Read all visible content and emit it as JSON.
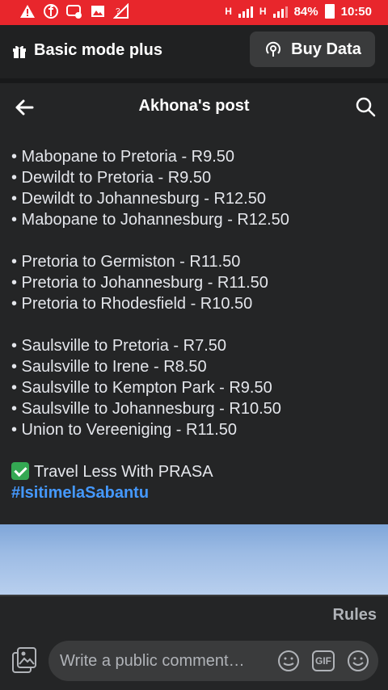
{
  "status_bar": {
    "net1": "H",
    "net2": "H",
    "battery": "84%",
    "time": "10:50"
  },
  "promo": {
    "title": "Basic mode plus",
    "buy_button": "Buy Data"
  },
  "header": {
    "title": "Akhona's post"
  },
  "post": {
    "group1": [
      "• Mabopane to Pretoria - R9.50",
      "• Dewildt to Pretoria - R9.50",
      "• Dewildt to Johannesburg - R12.50",
      "• Mabopane to Johannesburg - R12.50"
    ],
    "group2": [
      "• Pretoria to Germiston - R11.50",
      "• Pretoria to Johannesburg - R11.50",
      "• Pretoria to Rhodesfield - R10.50"
    ],
    "group3": [
      "• Saulsville to Pretoria - R7.50",
      "• Saulsville to Irene - R8.50",
      "• Saulsville to Kempton Park - R9.50",
      "• Saulsville to Johannesburg - R10.50",
      "• Union to Vereeniging - R11.50"
    ],
    "tagline": "Travel Less With PRASA",
    "hashtag": "#IsitimelaSabantu"
  },
  "footer": {
    "rules": "Rules",
    "comment_placeholder": "Write a public comment…",
    "gif_label": "GIF"
  },
  "colors": {
    "status_bar": "#e8262c",
    "background": "#242526",
    "hashtag": "#4599ff"
  }
}
